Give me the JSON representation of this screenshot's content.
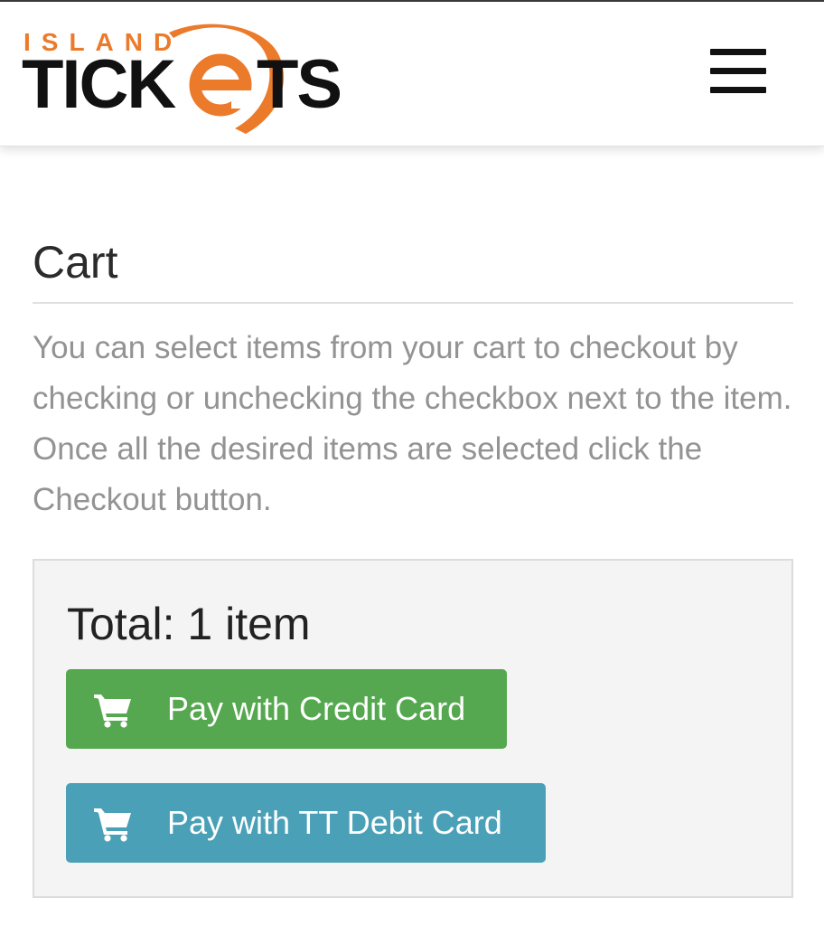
{
  "header": {
    "logo": {
      "top_text": "ISLAND",
      "main_text": "TICKETS",
      "colors": {
        "dark": "#111111",
        "accent": "#ec7a2b"
      }
    },
    "menu_icon": "hamburger-menu-icon"
  },
  "cart": {
    "title": "Cart",
    "instructions": "You can select items from your cart to checkout by checking or unchecking the checkbox next to the item. Once all the desired items are selected click the Checkout button.",
    "total_label": "Total: 1 item",
    "buttons": {
      "credit": {
        "label": "Pay with Credit Card",
        "icon": "shopping-cart-icon",
        "color": "#55a84f"
      },
      "debit": {
        "label": "Pay with TT Debit Card",
        "icon": "shopping-cart-icon",
        "color": "#4aa0b7"
      }
    }
  }
}
